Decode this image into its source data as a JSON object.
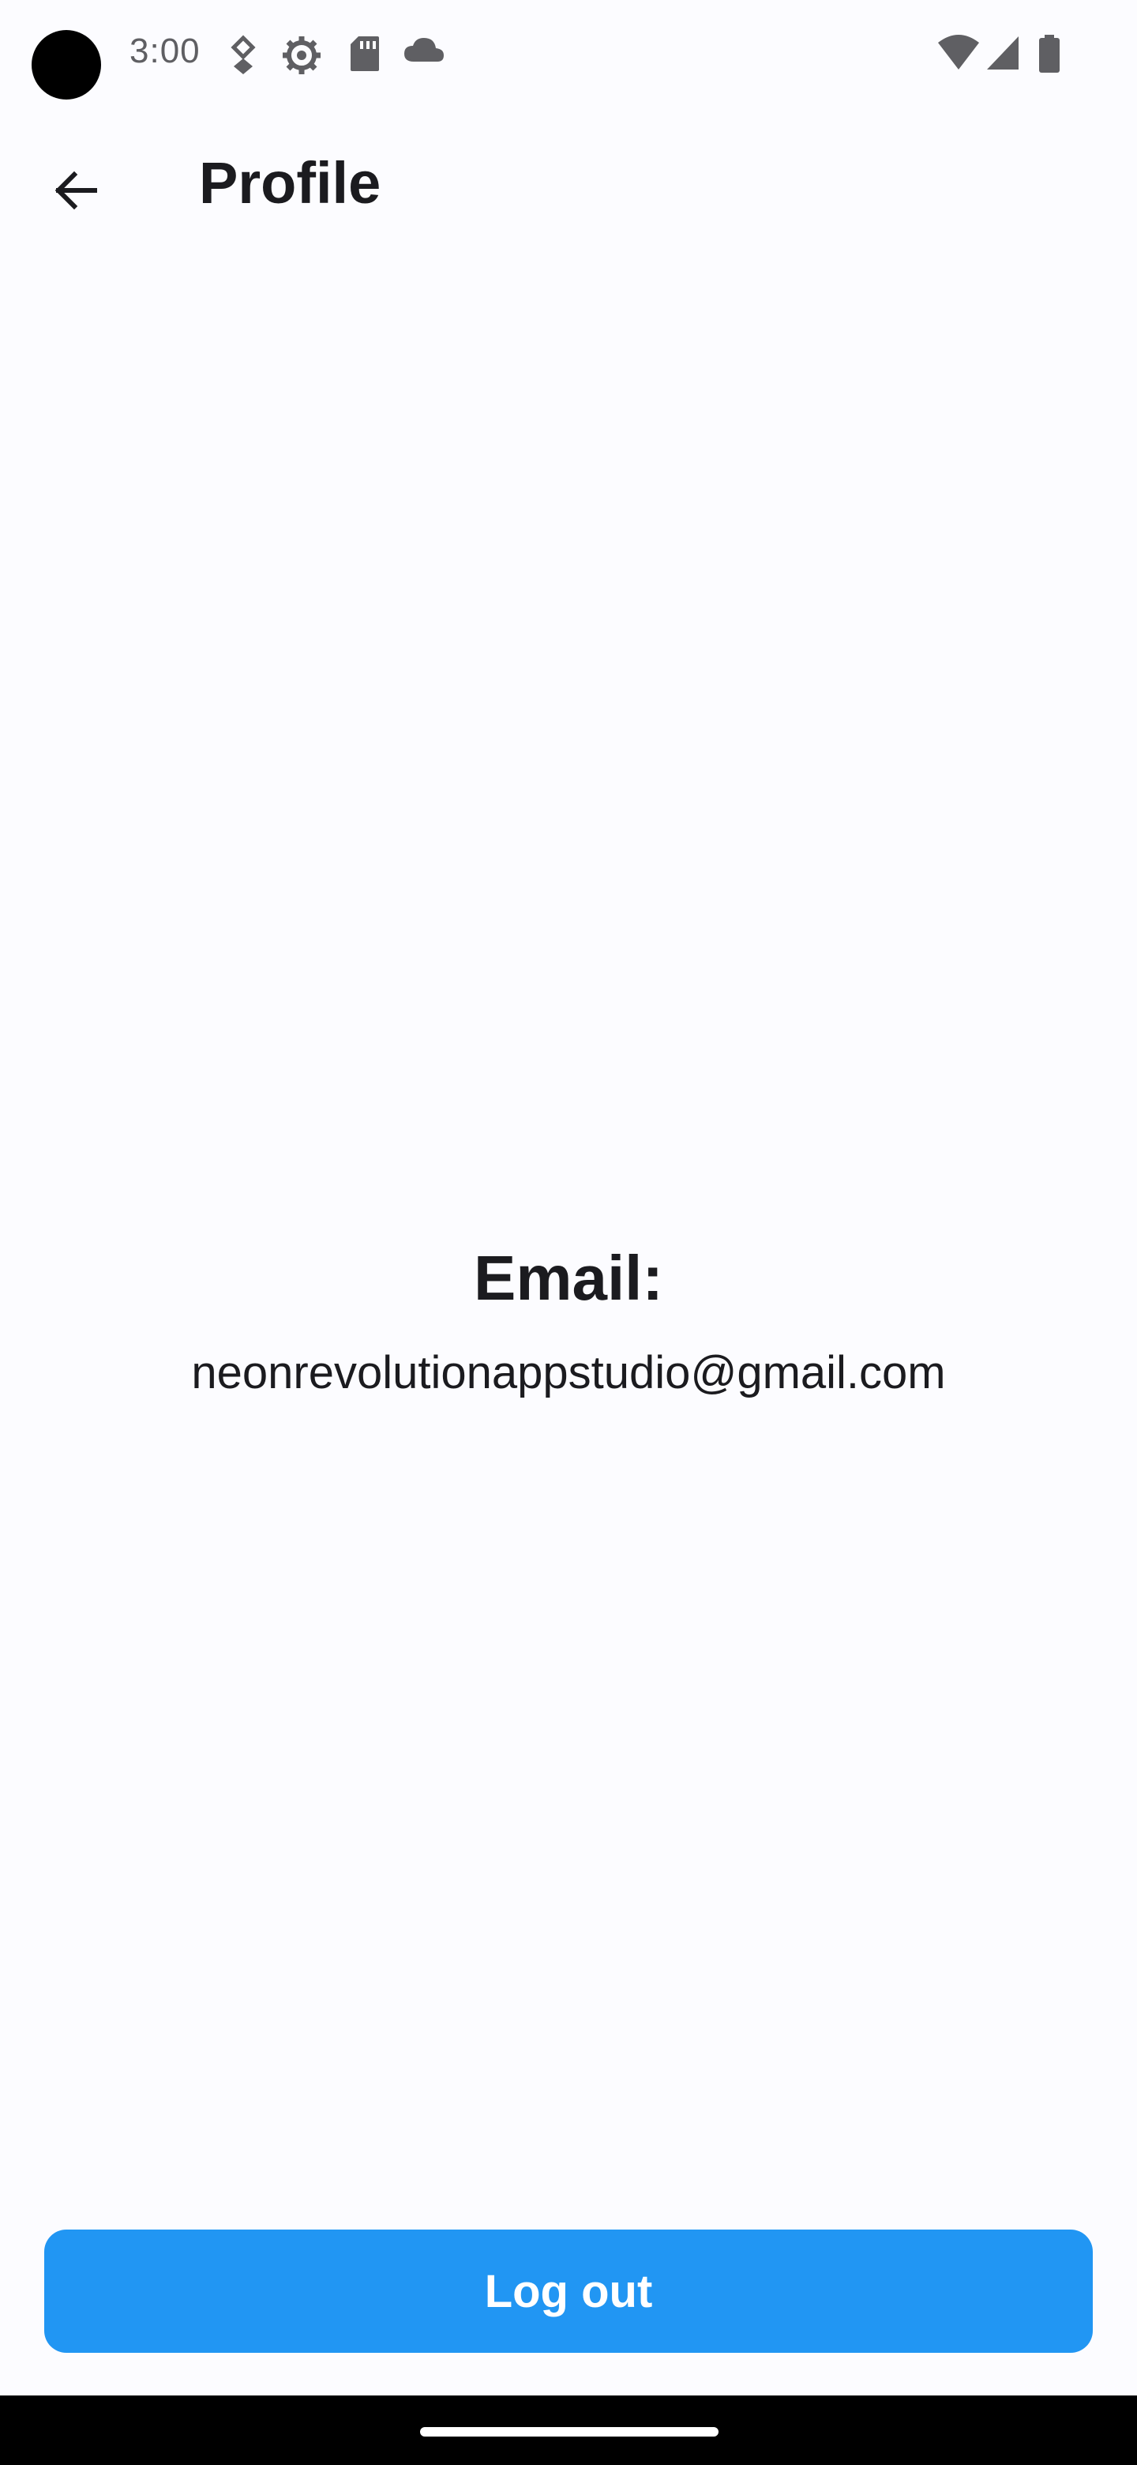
{
  "status_bar": {
    "time": "3:00",
    "icons": [
      "camera-cutout",
      "location-icon",
      "settings-gear-icon",
      "sd-card-icon",
      "cloud-icon",
      "wifi-icon",
      "cellular-signal-icon",
      "battery-icon"
    ]
  },
  "app_bar": {
    "back_icon": "arrow-back-icon",
    "title": "Profile"
  },
  "profile": {
    "email_heading": "Email:",
    "email_value": "neonrevolutionappstudio@gmail.com"
  },
  "actions": {
    "logout_label": "Log out"
  },
  "colors": {
    "background": "#fcfcff",
    "accent": "#2196f3",
    "text": "#1b1b1f",
    "nav_bar": "#000000"
  }
}
